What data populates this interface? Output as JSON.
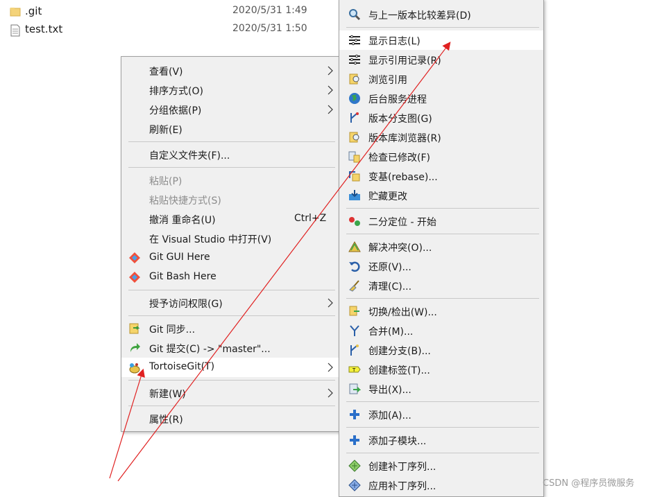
{
  "files": [
    {
      "name": ".git",
      "date": "2020/5/31 1:49",
      "icon": "folder-icon"
    },
    {
      "name": "test.txt",
      "date": "2020/5/31 1:50",
      "icon": "text-file-icon"
    }
  ],
  "context_menu": {
    "items": [
      {
        "label": "查看(V)"
      },
      {
        "label": "排序方式(O)"
      },
      {
        "label": "分组依据(P)"
      },
      {
        "label": "刷新(E)"
      },
      {
        "label": "自定义文件夹(F)..."
      },
      {
        "label": "粘贴(P)"
      },
      {
        "label": "粘贴快捷方式(S)"
      },
      {
        "label": "撤消 重命名(U)",
        "shortcut": "Ctrl+Z"
      },
      {
        "label": "在 Visual Studio 中打开(V)"
      },
      {
        "label": "Git GUI Here"
      },
      {
        "label": "Git Bash Here"
      },
      {
        "label": "授予访问权限(G)"
      },
      {
        "label": "Git 同步..."
      },
      {
        "label": "Git 提交(C) -> \"master\"..."
      },
      {
        "label": "TortoiseGit(T)"
      },
      {
        "label": "新建(W)"
      },
      {
        "label": "属性(R)"
      }
    ]
  },
  "tortoisegit_menu": {
    "items": [
      {
        "label": "与上一版本比较差异(D)"
      },
      {
        "label": "显示日志(L)"
      },
      {
        "label": "显示引用记录(R)"
      },
      {
        "label": "浏览引用"
      },
      {
        "label": "后台服务进程"
      },
      {
        "label": "版本分支图(G)"
      },
      {
        "label": "版本库浏览器(R)"
      },
      {
        "label": "检查已修改(F)"
      },
      {
        "label": "变基(rebase)..."
      },
      {
        "label": "贮藏更改"
      },
      {
        "label": "二分定位 - 开始"
      },
      {
        "label": "解决冲突(O)..."
      },
      {
        "label": "还原(V)..."
      },
      {
        "label": "清理(C)..."
      },
      {
        "label": "切换/检出(W)..."
      },
      {
        "label": "合并(M)..."
      },
      {
        "label": "创建分支(B)..."
      },
      {
        "label": "创建标签(T)..."
      },
      {
        "label": "导出(X)..."
      },
      {
        "label": "添加(A)..."
      },
      {
        "label": "添加子模块..."
      },
      {
        "label": "创建补丁序列..."
      },
      {
        "label": "应用补丁序列..."
      }
    ]
  },
  "watermark": "CSDN @程序员微服务",
  "colors": {
    "menu_bg": "#f0f0f0",
    "highlight": "#ffffff",
    "annotation_arrow": "#e02020",
    "disabled_text": "#8c8c8c"
  }
}
